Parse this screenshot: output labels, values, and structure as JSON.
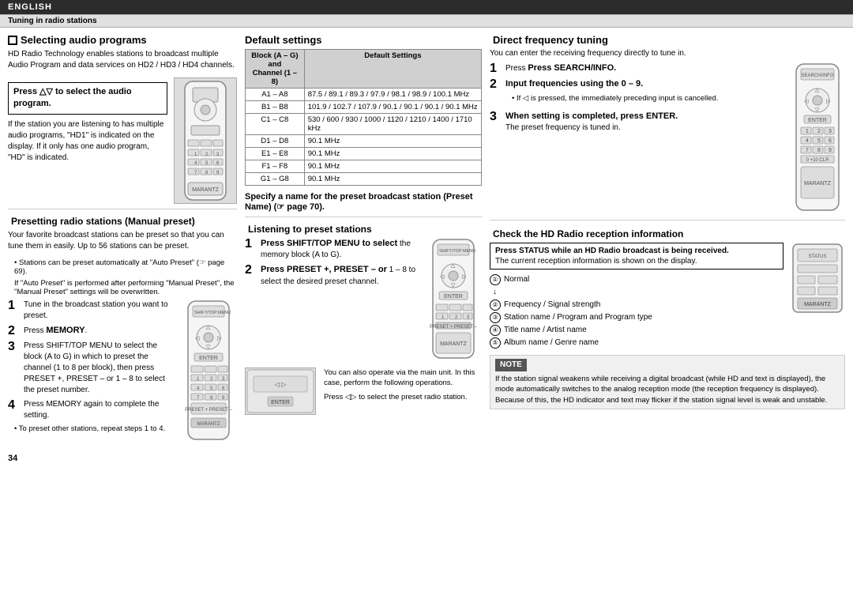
{
  "topbar": {
    "label": "ENGLISH"
  },
  "tuningbar": {
    "label": "Tuning in radio stations"
  },
  "left": {
    "selecting_title": "Selecting audio programs",
    "selecting_body": "HD Radio Technology enables stations to broadcast multiple Audio Program and data services on HD2 / HD3 / HD4 channels.",
    "press_triangle_box": "Press △▽ to select the audio program.",
    "press_triangle_body": "If the station you are listening to has multiple audio programs, \"HD1\" is indicated on the display. If it only has one audio program, \"HD\" is indicated.",
    "presetting_title": "Presetting radio stations (Manual preset)",
    "presetting_body": "Your favorite broadcast stations can be preset so that you can tune them in easily. Up to 56 stations can be preset.",
    "bullet1": "• Stations can be preset automatically at \"Auto Preset\" (☞ page 69).",
    "bullet2": "If \"Auto Preset\" is performed after performing \"Manual Preset\", the \"Manual Preset\" settings will be overwritten.",
    "step1_num": "1",
    "step1_text": "Tune in the broadcast station you want to preset.",
    "step2_num": "2",
    "step2_text": "Press MEMORY.",
    "step3_num": "3",
    "step3_text": "Press SHIFT/TOP MENU to select the block (A to G) in which to preset the channel (1 to 8 per block), then press PRESET +, PRESET – or 1 – 8 to select the preset number.",
    "step4_num": "4",
    "step4_text": "Press MEMORY again to complete the setting.",
    "bullet3": "• To preset other stations, repeat steps 1 to 4."
  },
  "middle": {
    "default_title": "Default settings",
    "table_headers": [
      "Block (A – G) and Channel (1 – 8)",
      "Default Settings"
    ],
    "table_rows": [
      {
        "block": "A1 – A8",
        "settings": "87.5 / 89.1 / 89.3 / 97.9 / 98.1 / 98.9 / 100.1 MHz"
      },
      {
        "block": "B1 – B8",
        "settings": "101.9 / 102.7 / 107.9 / 90.1 / 90.1 / 90.1 / 90.1 MHz"
      },
      {
        "block": "C1 – C8",
        "settings": "530 / 600 / 930 / 1000 / 1120 / 1210 / 1400 / 1710 kHz"
      },
      {
        "block": "D1 – D8",
        "settings": "90.1 MHz"
      },
      {
        "block": "E1 – E8",
        "settings": "90.1 MHz"
      },
      {
        "block": "F1 – F8",
        "settings": "90.1 MHz"
      },
      {
        "block": "G1 – G8",
        "settings": "90.1 MHz"
      }
    ],
    "specify_title": "Specify a name for the preset broadcast station (Preset Name) (☞ page 70).",
    "listening_title": "Listening to preset stations",
    "listen_step1_num": "1",
    "listen_step1_bold": "Press SHIFT/TOP MENU to select",
    "listen_step1_text": " the memory block (A to G).",
    "listen_step2_num": "2",
    "listen_step2_bold": "Press PRESET +, PRESET – or",
    "listen_step2_text": " 1 – 8 to select the desired preset channel.",
    "bottom_text1": "You can also operate via the main unit. In this case, perform the following operations.",
    "bottom_text2": "Press ◁▷ to select the preset radio station."
  },
  "right": {
    "direct_title": "Direct frequency tuning",
    "direct_intro": "You can enter the receiving frequency directly to tune in.",
    "step1_num": "1",
    "step1_bold": "Press SEARCH/INFO.",
    "step2_num": "2",
    "step2_bold": "Input frequencies using the 0 – 9.",
    "step2_bullet": "• If ◁ is pressed, the immediately preceding input is cancelled.",
    "step3_num": "3",
    "step3_bold": "When setting is completed, press ENTER.",
    "step3_text": "The preset frequency is tuned in.",
    "check_hd_title": "Check the HD Radio reception information",
    "hd_press_box_bold": "Press STATUS while an HD Radio broadcast is being received.",
    "hd_press_box_text": "The current reception information is shown on the display.",
    "hd_list": [
      {
        "num": "①",
        "text": "Normal"
      },
      {
        "num": "↓",
        "text": ""
      },
      {
        "num": "②",
        "text": "Frequency / Signal strength"
      },
      {
        "num": "",
        "text": ""
      },
      {
        "num": "③",
        "text": "Station name / Program and Program type"
      },
      {
        "num": "",
        "text": ""
      },
      {
        "num": "④",
        "text": "Title name / Artist name"
      },
      {
        "num": "",
        "text": ""
      },
      {
        "num": "⑤",
        "text": "Album name / Genre name"
      }
    ],
    "note_label": "NOTE",
    "note_text": "If the station signal weakens while receiving a digital broadcast (while HD and text is displayed), the mode automatically switches to the analog reception mode (the reception frequency is displayed). Because of this, the HD indicator and text may flicker if the station signal level is weak and unstable."
  },
  "page_number": "34"
}
